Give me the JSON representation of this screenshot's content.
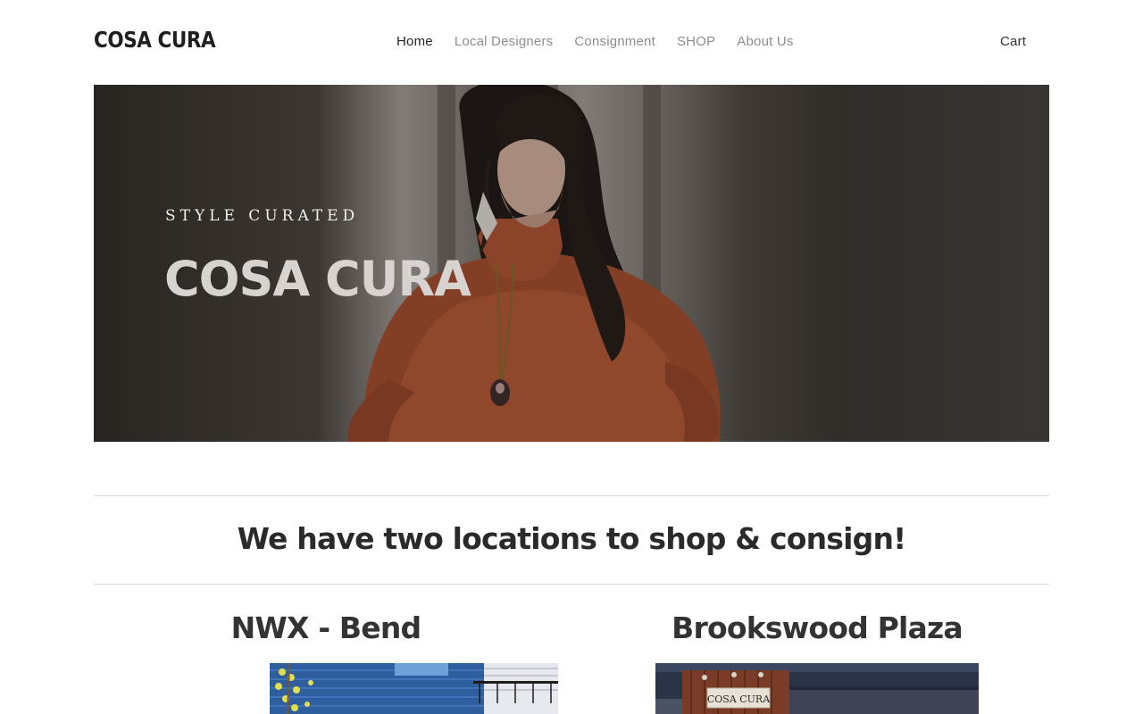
{
  "header": {
    "logo": "COSA CURA",
    "nav": [
      {
        "label": "Home",
        "active": true
      },
      {
        "label": "Local Designers",
        "active": false
      },
      {
        "label": "Consignment",
        "active": false
      },
      {
        "label": "SHOP",
        "active": false
      },
      {
        "label": "About Us",
        "active": false
      }
    ],
    "cart_label": "Cart"
  },
  "hero": {
    "eyebrow": "STYLE CURATED",
    "title": "COSA CURA"
  },
  "locations": {
    "heading": "We have two locations to shop & consign!",
    "items": [
      {
        "title": "NWX - Bend"
      },
      {
        "title": "Brookswood Plaza",
        "sign_text": "COSA CURA"
      }
    ]
  },
  "colors": {
    "nav_active": "#222222",
    "nav_inactive": "#8d8d8d",
    "heading": "#2a2a2a"
  }
}
